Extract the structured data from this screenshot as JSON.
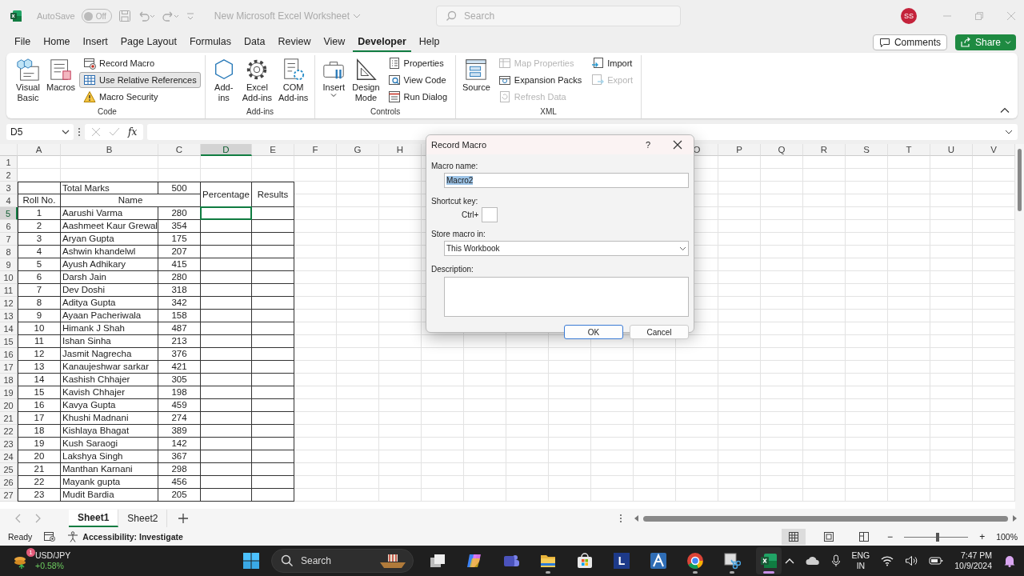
{
  "title_bar": {
    "autosave_label": "AutoSave",
    "autosave": {
      "label": "Off",
      "on": false
    },
    "document_title": "New Microsoft Excel Worksheet",
    "search": {
      "placeholder": "Search"
    },
    "avatar": "SS"
  },
  "menu_tabs": [
    {
      "label": "File",
      "selected": false
    },
    {
      "label": "Home",
      "selected": false
    },
    {
      "label": "Insert",
      "selected": false
    },
    {
      "label": "Page Layout",
      "selected": false
    },
    {
      "label": "Formulas",
      "selected": false
    },
    {
      "label": "Data",
      "selected": false
    },
    {
      "label": "Review",
      "selected": false
    },
    {
      "label": "View",
      "selected": false
    },
    {
      "label": "Developer",
      "selected": true
    },
    {
      "label": "Help",
      "selected": false
    }
  ],
  "comments_button": "Comments",
  "share_button": "Share",
  "ribbon": {
    "groups": [
      {
        "label": "Code",
        "items": [
          {
            "kind": "large",
            "label": "Visual\nBasic",
            "disabled": false,
            "selected": false,
            "dropdown": false
          },
          {
            "kind": "large",
            "label": "Macros",
            "disabled": false,
            "selected": false,
            "dropdown": false
          },
          {
            "kind": "small",
            "label": "Record Macro",
            "disabled": false,
            "selected": false,
            "dropdown": false
          },
          {
            "kind": "small",
            "label": "Use Relative References",
            "disabled": false,
            "selected": true,
            "dropdown": false
          },
          {
            "kind": "small",
            "label": "Macro Security",
            "disabled": false,
            "selected": false,
            "dropdown": false
          }
        ]
      },
      {
        "label": "Add-ins",
        "items": [
          {
            "kind": "large",
            "label": "Add-\nins",
            "disabled": false,
            "selected": false,
            "dropdown": false
          },
          {
            "kind": "large",
            "label": "Excel\nAdd-ins",
            "disabled": false,
            "selected": false,
            "dropdown": false
          },
          {
            "kind": "large",
            "label": "COM\nAdd-ins",
            "disabled": false,
            "selected": false,
            "dropdown": false
          }
        ]
      },
      {
        "label": "Controls",
        "items": [
          {
            "kind": "large",
            "label": "Insert",
            "disabled": false,
            "selected": false,
            "dropdown": true
          },
          {
            "kind": "large",
            "label": "Design\nMode",
            "disabled": false,
            "selected": false,
            "dropdown": false
          },
          {
            "kind": "small",
            "label": "Properties",
            "disabled": false,
            "selected": false,
            "dropdown": false
          },
          {
            "kind": "small",
            "label": "View Code",
            "disabled": false,
            "selected": false,
            "dropdown": false
          },
          {
            "kind": "small",
            "label": "Run Dialog",
            "disabled": false,
            "selected": false,
            "dropdown": false
          }
        ]
      },
      {
        "label": "XML",
        "items": [
          {
            "kind": "large",
            "label": "Source",
            "disabled": false,
            "selected": false,
            "dropdown": false
          },
          {
            "kind": "small",
            "label": "Map Properties",
            "disabled": true,
            "selected": false,
            "dropdown": false
          },
          {
            "kind": "small",
            "label": "Expansion Packs",
            "disabled": false,
            "selected": false,
            "dropdown": false
          },
          {
            "kind": "small",
            "label": "Refresh Data",
            "disabled": true,
            "selected": false,
            "dropdown": false
          },
          {
            "kind": "small",
            "label": "Import",
            "disabled": false,
            "selected": false,
            "dropdown": false
          },
          {
            "kind": "small",
            "label": "Export",
            "disabled": true,
            "selected": false,
            "dropdown": false
          }
        ]
      }
    ]
  },
  "formula_bar": {
    "name_box": "D5",
    "function_label": "fx"
  },
  "sheet": {
    "columns": [
      {
        "letter": "A",
        "selected": false
      },
      {
        "letter": "B",
        "selected": false
      },
      {
        "letter": "C",
        "selected": false
      },
      {
        "letter": "D",
        "selected": true
      },
      {
        "letter": "E",
        "selected": false
      },
      {
        "letter": "F",
        "selected": false
      },
      {
        "letter": "G",
        "selected": false
      },
      {
        "letter": "H",
        "selected": false
      },
      {
        "letter": "O",
        "selected": false
      },
      {
        "letter": "P",
        "selected": false
      },
      {
        "letter": "Q",
        "selected": false
      },
      {
        "letter": "R",
        "selected": false
      },
      {
        "letter": "S",
        "selected": false
      },
      {
        "letter": "T",
        "selected": false
      },
      {
        "letter": "U",
        "selected": false
      },
      {
        "letter": "V",
        "selected": false
      }
    ],
    "rows": [
      {
        "label": "1",
        "selected": false
      },
      {
        "label": "2",
        "selected": false
      },
      {
        "label": "3",
        "selected": false
      },
      {
        "label": "4",
        "selected": false
      },
      {
        "label": "5",
        "selected": true
      },
      {
        "label": "6",
        "selected": false
      },
      {
        "label": "7",
        "selected": false
      },
      {
        "label": "8",
        "selected": false
      },
      {
        "label": "9",
        "selected": false
      },
      {
        "label": "10",
        "selected": false
      },
      {
        "label": "11",
        "selected": false
      },
      {
        "label": "12",
        "selected": false
      },
      {
        "label": "13",
        "selected": false
      },
      {
        "label": "14",
        "selected": false
      },
      {
        "label": "15",
        "selected": false
      },
      {
        "label": "16",
        "selected": false
      },
      {
        "label": "17",
        "selected": false
      },
      {
        "label": "18",
        "selected": false
      },
      {
        "label": "19",
        "selected": false
      },
      {
        "label": "20",
        "selected": false
      },
      {
        "label": "21",
        "selected": false
      },
      {
        "label": "22",
        "selected": false
      },
      {
        "label": "23",
        "selected": false
      },
      {
        "label": "24",
        "selected": false
      },
      {
        "label": "25",
        "selected": false
      },
      {
        "label": "26",
        "selected": false
      },
      {
        "label": "27",
        "selected": false
      }
    ],
    "total_marks_label": "Total Marks",
    "total_marks_value": "500",
    "percentage_header": "Percentage",
    "results_header": "Results",
    "roll_header": "Roll No.",
    "name_header": "Name",
    "students": [
      {
        "roll": "1",
        "name": "Aarushi Varma",
        "marks": "280"
      },
      {
        "roll": "2",
        "name": "Aashmeet Kaur Grewal",
        "marks": "354"
      },
      {
        "roll": "3",
        "name": "Aryan Gupta",
        "marks": "175"
      },
      {
        "roll": "4",
        "name": "Ashwin khandelwl",
        "marks": "207"
      },
      {
        "roll": "5",
        "name": "Ayush Adhikary",
        "marks": "415"
      },
      {
        "roll": "6",
        "name": "Darsh Jain",
        "marks": "280"
      },
      {
        "roll": "7",
        "name": "Dev Doshi",
        "marks": "318"
      },
      {
        "roll": "8",
        "name": "Aditya Gupta",
        "marks": "342"
      },
      {
        "roll": "9",
        "name": "Ayaan Pacheriwala",
        "marks": "158"
      },
      {
        "roll": "10",
        "name": "Himank J Shah",
        "marks": "487"
      },
      {
        "roll": "11",
        "name": "Ishan Sinha",
        "marks": "213"
      },
      {
        "roll": "12",
        "name": "Jasmit Nagrecha",
        "marks": "376"
      },
      {
        "roll": "13",
        "name": "Kanaujeshwar sarkar",
        "marks": "421"
      },
      {
        "roll": "14",
        "name": "Kashish Chhajer",
        "marks": "305"
      },
      {
        "roll": "15",
        "name": "Kavish Chhajer",
        "marks": "198"
      },
      {
        "roll": "16",
        "name": "Kavya Gupta",
        "marks": "459"
      },
      {
        "roll": "17",
        "name": "Khushi Madnani",
        "marks": "274"
      },
      {
        "roll": "18",
        "name": "Kishlaya Bhagat",
        "marks": "389"
      },
      {
        "roll": "19",
        "name": "Kush Saraogi",
        "marks": "142"
      },
      {
        "roll": "20",
        "name": "Lakshya Singh",
        "marks": "367"
      },
      {
        "roll": "21",
        "name": "Manthan Karnani",
        "marks": "298"
      },
      {
        "roll": "22",
        "name": "Mayank gupta",
        "marks": "456"
      },
      {
        "roll": "23",
        "name": "Mudit Bardia",
        "marks": "205"
      }
    ]
  },
  "sheet_tabs": [
    {
      "label": "Sheet1",
      "selected": true
    },
    {
      "label": "Sheet2",
      "selected": false
    }
  ],
  "status_bar": {
    "ready": "Ready",
    "accessibility": "Accessibility: Investigate",
    "views": [
      {
        "selected": true
      },
      {
        "selected": false
      },
      {
        "selected": false
      }
    ],
    "zoom_out": "−",
    "zoom_in": "+",
    "zoom": {
      "level": 0.52
    },
    "zoom_label": "100%"
  },
  "dialog": {
    "title": "Record Macro",
    "help": "?",
    "macro_name_label": "Macro name:",
    "macro_name": {
      "value": "Macro2",
      "text_selected": true
    },
    "shortcut_label": "Shortcut key:",
    "ctrl_label": "Ctrl+",
    "store_label": "Store macro in:",
    "store_value": "This Workbook",
    "description_label": "Description:",
    "ok": "OK",
    "cancel": "Cancel"
  },
  "taskbar": {
    "widget": {
      "badge": "1",
      "title": "USD/JPY",
      "change": "+0.58%"
    },
    "search_placeholder": "Search",
    "apps": [
      {
        "running": false,
        "active": false
      },
      {
        "running": false,
        "active": false
      },
      {
        "running": false,
        "active": false
      },
      {
        "running": true,
        "active": false
      },
      {
        "running": false,
        "active": false
      },
      {
        "running": false,
        "active": false,
        "glyph": "L"
      },
      {
        "running": false,
        "active": false
      },
      {
        "running": true,
        "active": false
      },
      {
        "running": true,
        "active": false
      },
      {
        "running": true,
        "active": true
      }
    ],
    "language": [
      "ENG",
      "IN"
    ],
    "time": "7:47 PM",
    "date": "10/9/2024"
  }
}
